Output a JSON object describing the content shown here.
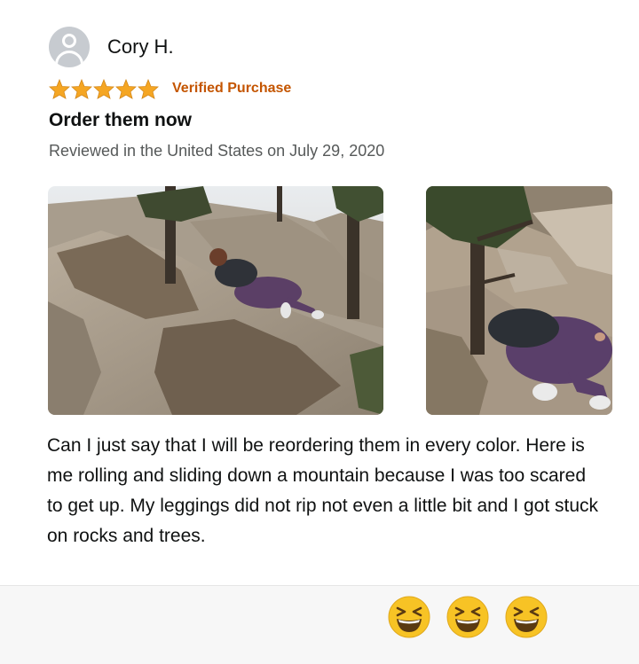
{
  "reviewer": {
    "name": "Cory H.",
    "avatar_icon": "person-silhouette-icon"
  },
  "rating": {
    "stars": 5,
    "out_of": 5,
    "star_color": "#f5a623",
    "verified_label": "Verified Purchase",
    "verified_color": "#c45500"
  },
  "review": {
    "title": "Order them now",
    "date": "Reviewed in the United States on July 29, 2020",
    "body": "Can I just say that I will be reordering them in every color. Here is me rolling and sliding down a mountain because I was too scared to get up. My leggings did not rip not even a little bit and I got stuck on rocks and trees."
  },
  "photos": [
    {
      "icon": "review-photo-1"
    },
    {
      "icon": "review-photo-2"
    }
  ],
  "footer": {
    "emoji_icon": "grinning-squinting-face-icon",
    "emoji_count": 3
  }
}
